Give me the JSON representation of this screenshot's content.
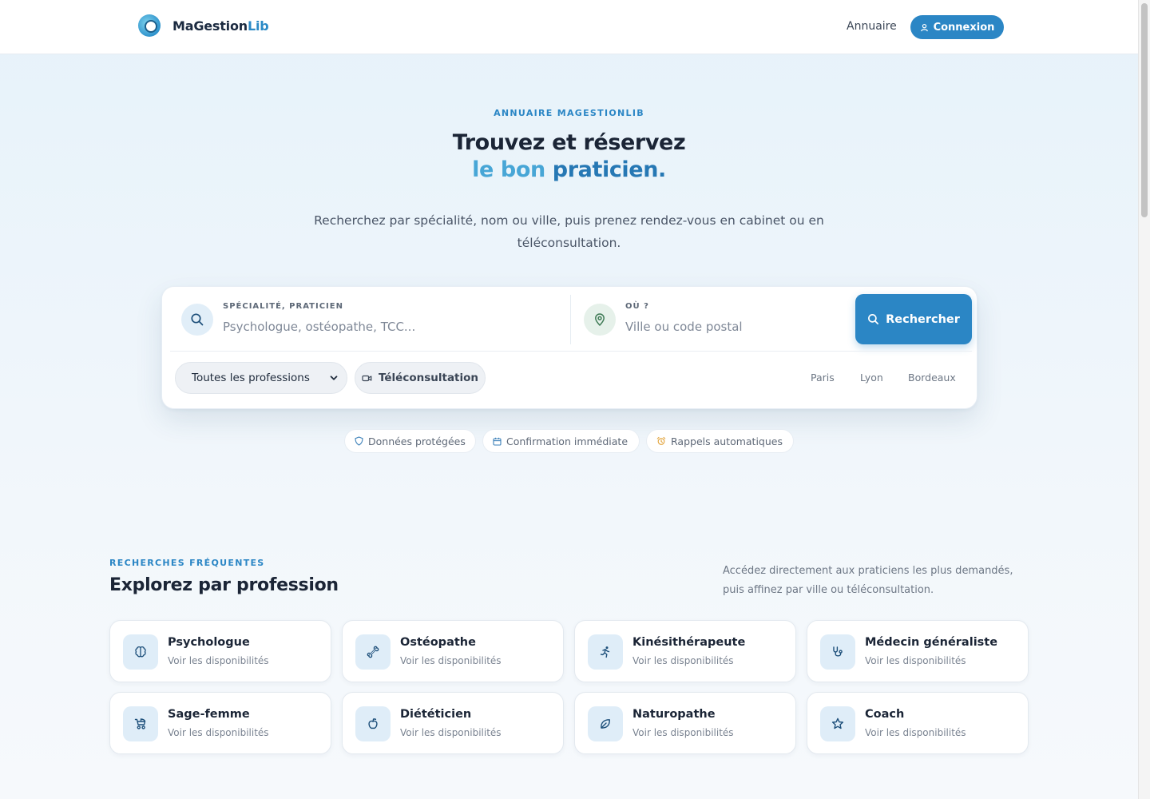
{
  "header": {
    "logo_text": "MaGestion",
    "logo_accent": "Lib",
    "nav_link": "Annuaire",
    "login_label": "Connexion"
  },
  "hero": {
    "eyebrow": "ANNUAIRE MAGESTIONLIB",
    "title_line1": "Trouvez et réservez",
    "title_line2_a": "le bon",
    "title_line2_b": "praticien.",
    "subtitle": "Recherchez par spécialité, nom ou ville, puis prenez rendez-vous en cabinet ou en téléconsultation."
  },
  "search": {
    "specialty_label": "SPÉCIALITÉ, PRATICIEN",
    "specialty_placeholder": "Psychologue, ostéopathe, TCC...",
    "location_label": "OÙ ?",
    "location_placeholder": "Ville ou code postal",
    "search_button": "Rechercher",
    "profession_select": "Toutes les professions",
    "teleconsultation_chip": "Téléconsultation",
    "cities": [
      "Paris",
      "Lyon",
      "Bordeaux"
    ]
  },
  "trust_badges": [
    "Données protégées",
    "Confirmation immédiate",
    "Rappels automatiques"
  ],
  "professions_section": {
    "eyebrow": "RECHERCHES FRÉQUENTES",
    "title": "Explorez par profession",
    "description": "Accédez directement aux praticiens les plus demandés, puis affinez par ville ou téléconsultation.",
    "items": [
      {
        "name": "Psychologue",
        "sub": "Voir les disponibilités",
        "icon": "brain-icon"
      },
      {
        "name": "Ostéopathe",
        "sub": "Voir les disponibilités",
        "icon": "bone-icon"
      },
      {
        "name": "Kinésithérapeute",
        "sub": "Voir les disponibilités",
        "icon": "running-person-icon"
      },
      {
        "name": "Médecin généraliste",
        "sub": "Voir les disponibilités",
        "icon": "stethoscope-icon"
      },
      {
        "name": "Sage-femme",
        "sub": "Voir les disponibilités",
        "icon": "stroller-icon"
      },
      {
        "name": "Diététicien",
        "sub": "Voir les disponibilités",
        "icon": "apple-icon"
      },
      {
        "name": "Naturopathe",
        "sub": "Voir les disponibilités",
        "icon": "leaf-icon"
      },
      {
        "name": "Coach",
        "sub": "Voir les disponibilités",
        "icon": "star-icon"
      }
    ]
  },
  "colors": {
    "accent": "#2b86c5",
    "accent_light": "#47a6d6",
    "title": "#1b2536"
  }
}
